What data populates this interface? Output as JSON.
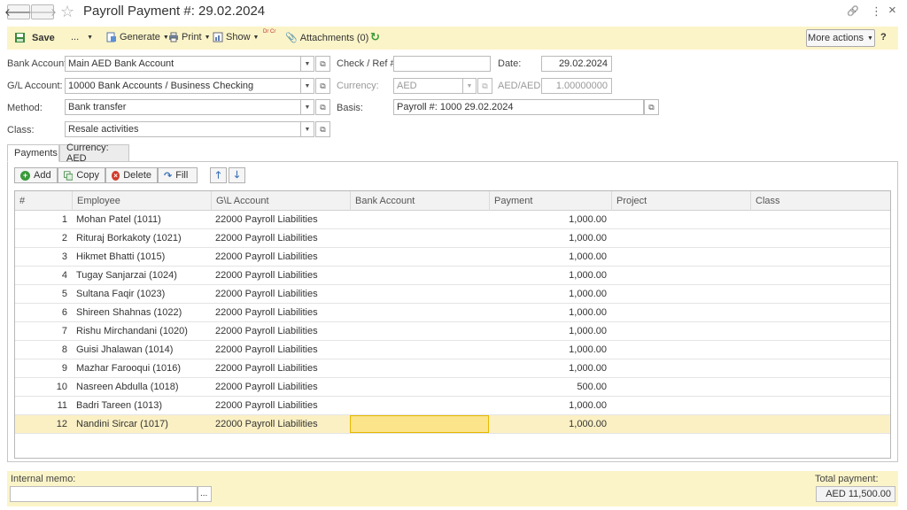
{
  "window": {
    "title": "Payroll Payment #:  29.02.2024",
    "back_glyph": "🡐",
    "forward_glyph": "🡒",
    "star_glyph": "☆",
    "link_glyph": "🔗",
    "kebab_glyph": "⋮",
    "close_glyph": "×"
  },
  "toolbar": {
    "save": "Save",
    "ellipsis": "...",
    "generate": "Generate",
    "print": "Print",
    "show": "Show",
    "drcr": "Dr Cr",
    "attachments": "Attachments (0)",
    "more_actions": "More actions",
    "help": "?"
  },
  "form": {
    "bank_account_label": "Bank Account:",
    "bank_account_value": "Main AED Bank Account",
    "gl_account_label": "G/L Account:",
    "gl_account_value": "10000 Bank Accounts / Business Checking",
    "method_label": "Method:",
    "method_value": "Bank transfer",
    "class_label": "Class:",
    "class_value": "Resale activities",
    "check_ref_label": "Check / Ref #:",
    "check_ref_value": "",
    "date_label": "Date:",
    "date_value": "29.02.2024",
    "currency_label": "Currency:",
    "currency_value": "AED",
    "rate_label": "AED/AED:",
    "rate_value": "1.00000000",
    "basis_label": "Basis:",
    "basis_value": "Payroll #: 1000 29.02.2024"
  },
  "tabs": [
    {
      "label": "Payments"
    },
    {
      "label": "Currency: AED"
    }
  ],
  "grid_toolbar": {
    "add": "Add",
    "copy": "Copy",
    "delete": "Delete",
    "fill": "Fill",
    "up_glyph": "🡑",
    "down_glyph": "🡓"
  },
  "table": {
    "columns": [
      "#",
      "Employee",
      "G\\L Account",
      "Bank Account",
      "Payment",
      "Project",
      "Class"
    ],
    "rows": [
      {
        "num": "1",
        "employee": "Mohan Patel (1011)",
        "gl": "22000 Payroll Liabilities",
        "bank": "",
        "payment": "1,000.00",
        "project": "",
        "class": ""
      },
      {
        "num": "2",
        "employee": "Rituraj Borkakoty (1021)",
        "gl": "22000 Payroll Liabilities",
        "bank": "",
        "payment": "1,000.00",
        "project": "",
        "class": ""
      },
      {
        "num": "3",
        "employee": "Hikmet Bhatti (1015)",
        "gl": "22000 Payroll Liabilities",
        "bank": "",
        "payment": "1,000.00",
        "project": "",
        "class": ""
      },
      {
        "num": "4",
        "employee": "Tugay Sanjarzai (1024)",
        "gl": "22000 Payroll Liabilities",
        "bank": "",
        "payment": "1,000.00",
        "project": "",
        "class": ""
      },
      {
        "num": "5",
        "employee": "Sultana Faqir (1023)",
        "gl": "22000 Payroll Liabilities",
        "bank": "",
        "payment": "1,000.00",
        "project": "",
        "class": ""
      },
      {
        "num": "6",
        "employee": "Shireen Shahnas (1022)",
        "gl": "22000 Payroll Liabilities",
        "bank": "",
        "payment": "1,000.00",
        "project": "",
        "class": ""
      },
      {
        "num": "7",
        "employee": "Rishu Mirchandani (1020)",
        "gl": "22000 Payroll Liabilities",
        "bank": "",
        "payment": "1,000.00",
        "project": "",
        "class": ""
      },
      {
        "num": "8",
        "employee": "Guisi Jhalawan (1014)",
        "gl": "22000 Payroll Liabilities",
        "bank": "",
        "payment": "1,000.00",
        "project": "",
        "class": ""
      },
      {
        "num": "9",
        "employee": "Mazhar Farooqui (1016)",
        "gl": "22000 Payroll Liabilities",
        "bank": "",
        "payment": "1,000.00",
        "project": "",
        "class": ""
      },
      {
        "num": "10",
        "employee": "Nasreen Abdulla (1018)",
        "gl": "22000 Payroll Liabilities",
        "bank": "",
        "payment": "500.00",
        "project": "",
        "class": ""
      },
      {
        "num": "11",
        "employee": "Badri Tareen (1013)",
        "gl": "22000 Payroll Liabilities",
        "bank": "",
        "payment": "1,000.00",
        "project": "",
        "class": ""
      },
      {
        "num": "12",
        "employee": "Nandini Sircar (1017)",
        "gl": "22000 Payroll Liabilities",
        "bank": "",
        "payment": "1,000.00",
        "project": "",
        "class": ""
      }
    ],
    "selected_row": 11
  },
  "footer": {
    "memo_label": "Internal memo:",
    "memo_value": "",
    "memo_button": "...",
    "total_label": "Total payment:",
    "total_value": "AED 11,500.00"
  },
  "colors": {
    "toolbar_bg": "#fbf4c8",
    "selected_row_bg": "#fbf0c4",
    "active_cell_border": "#e6b800"
  }
}
